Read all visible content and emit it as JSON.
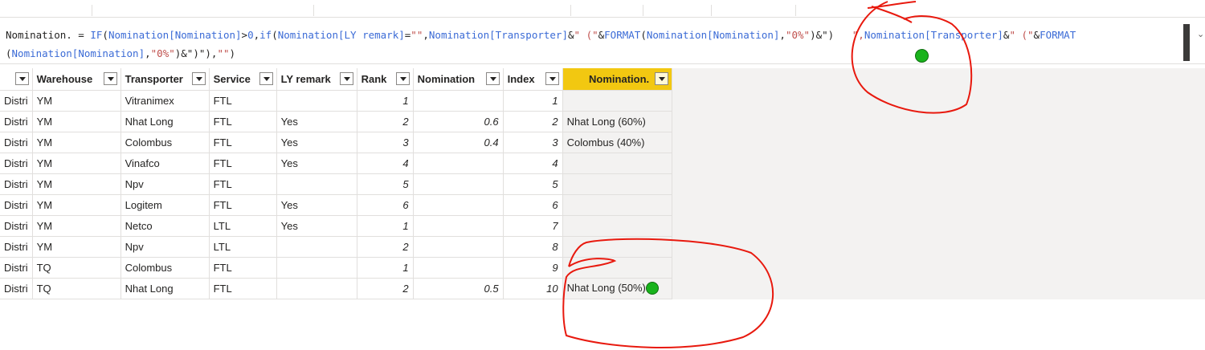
{
  "formula": {
    "lines": [
      [
        {
          "t": "Nomination. = ",
          "c": "tok"
        },
        {
          "t": "IF",
          "c": "kw"
        },
        {
          "t": "(",
          "c": "tok"
        },
        {
          "t": "Nomination[Nomination]",
          "c": "kw"
        },
        {
          "t": ">",
          "c": "tok"
        },
        {
          "t": "0",
          "c": "kw"
        },
        {
          "t": ",",
          "c": "tok"
        },
        {
          "t": "if",
          "c": "kw"
        },
        {
          "t": "(",
          "c": "tok"
        },
        {
          "t": "Nomination[LY remark]",
          "c": "kw"
        },
        {
          "t": "=",
          "c": "tok"
        },
        {
          "t": "\"\"",
          "c": "str"
        },
        {
          "t": ",",
          "c": "tok"
        },
        {
          "t": "Nomination[Transporter]",
          "c": "kw"
        },
        {
          "t": "&",
          "c": "tok"
        },
        {
          "t": "\" (\"",
          "c": "str"
        },
        {
          "t": "&",
          "c": "tok"
        },
        {
          "t": "FORMAT",
          "c": "kw"
        },
        {
          "t": "(",
          "c": "tok"
        },
        {
          "t": "Nomination[Nomination]",
          "c": "kw"
        },
        {
          "t": ",",
          "c": "tok"
        },
        {
          "t": "\"0%\"",
          "c": "str"
        },
        {
          "t": ")&\")",
          "c": "tok"
        },
        {
          "t": "   ",
          "c": "tok"
        },
        {
          "t": "\",",
          "c": "str"
        },
        {
          "t": "Nomination[Transporter]",
          "c": "kw"
        },
        {
          "t": "&",
          "c": "tok"
        },
        {
          "t": "\" (\"",
          "c": "str"
        },
        {
          "t": "&",
          "c": "tok"
        },
        {
          "t": "FORMAT",
          "c": "kw"
        }
      ],
      [
        {
          "t": "(",
          "c": "tok"
        },
        {
          "t": "Nomination[Nomination]",
          "c": "kw"
        },
        {
          "t": ",",
          "c": "tok"
        },
        {
          "t": "\"0%\"",
          "c": "str"
        },
        {
          "t": ")&\")\")",
          "c": "tok"
        },
        {
          "t": ",",
          "c": "tok"
        },
        {
          "t": "\"\"",
          "c": "str"
        },
        {
          "t": ")",
          "c": "tok"
        }
      ]
    ]
  },
  "table": {
    "columns": [
      {
        "label": "",
        "width": 38,
        "selected": false
      },
      {
        "label": "Warehouse",
        "width": 110,
        "selected": false
      },
      {
        "label": "Transporter",
        "width": 110,
        "selected": false
      },
      {
        "label": "Service",
        "width": 84,
        "selected": false
      },
      {
        "label": "LY remark",
        "width": 100,
        "selected": false
      },
      {
        "label": "Rank",
        "width": 70,
        "selected": false
      },
      {
        "label": "Nomination",
        "width": 112,
        "selected": false
      },
      {
        "label": "Index",
        "width": 74,
        "selected": false
      },
      {
        "label": "Nomination.",
        "width": 136,
        "selected": true
      }
    ],
    "rows": [
      [
        "Distri",
        "YM",
        "Vitranimex",
        "FTL",
        "",
        "1",
        "",
        "1",
        ""
      ],
      [
        "Distri",
        "YM",
        "Nhat Long",
        "FTL",
        "Yes",
        "2",
        "0.6",
        "2",
        "Nhat Long (60%)"
      ],
      [
        "Distri",
        "YM",
        "Colombus",
        "FTL",
        "Yes",
        "3",
        "0.4",
        "3",
        "Colombus (40%)"
      ],
      [
        "Distri",
        "YM",
        "Vinafco",
        "FTL",
        "Yes",
        "4",
        "",
        "4",
        ""
      ],
      [
        "Distri",
        "YM",
        "Npv",
        "FTL",
        "",
        "5",
        "",
        "5",
        ""
      ],
      [
        "Distri",
        "YM",
        "Logitem",
        "FTL",
        "Yes",
        "6",
        "",
        "6",
        ""
      ],
      [
        "Distri",
        "YM",
        "Netco",
        "LTL",
        "Yes",
        "1",
        "",
        "7",
        ""
      ],
      [
        "Distri",
        "YM",
        "Npv",
        "LTL",
        "",
        "2",
        "",
        "8",
        ""
      ],
      [
        "Distri",
        "TQ",
        "Colombus",
        "FTL",
        "",
        "1",
        "",
        "9",
        ""
      ],
      [
        "Distri",
        "TQ",
        "Nhat Long",
        "FTL",
        "",
        "2",
        "0.5",
        "10",
        "Nhat Long (50%)"
      ]
    ],
    "numeric_columns": [
      5,
      6,
      7
    ],
    "dot_row": 9
  },
  "colors": {
    "selected_header": "#f2c811",
    "dax_keyword": "#3b6bd6",
    "dax_string": "#c0504d",
    "annotation": "#e8190e",
    "marker": "#19b31c"
  }
}
